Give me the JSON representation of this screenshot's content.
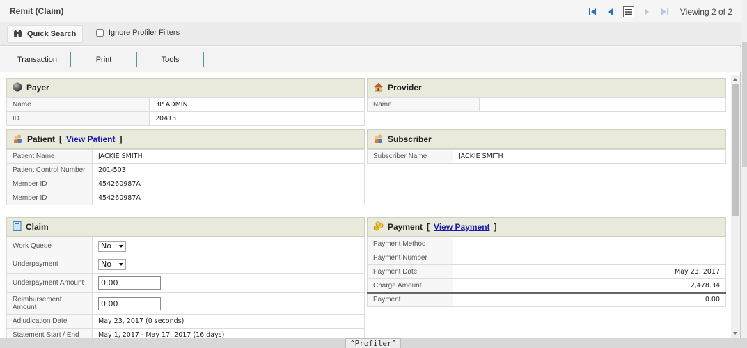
{
  "window": {
    "title": "Remit (Claim)",
    "viewing": "Viewing 2 of 2"
  },
  "toolbar": {
    "quick_search": "Quick Search",
    "ignore_filters": "Ignore Profiler Filters"
  },
  "tabs": [
    "Transaction",
    "Print",
    "Tools"
  ],
  "payer": {
    "title": "Payer",
    "rows": [
      {
        "label": "Name",
        "value": "3P ADMIN"
      },
      {
        "label": "ID",
        "value": "20413"
      }
    ]
  },
  "provider": {
    "title": "Provider",
    "rows": [
      {
        "label": "Name",
        "value": ""
      }
    ]
  },
  "patient": {
    "title": "Patient",
    "bracket_open": "[",
    "link": "View Patient",
    "bracket_close": "]",
    "rows": [
      {
        "label": "Patient Name",
        "value": "JACKIE SMITH"
      },
      {
        "label": "Patient Control Number",
        "value": "201-503"
      },
      {
        "label": "Member ID",
        "value": "454260987A"
      },
      {
        "label": "Member ID",
        "value": "454260987A"
      }
    ]
  },
  "subscriber": {
    "title": "Subscriber",
    "rows": [
      {
        "label": "Subscriber Name",
        "value": "JACKIE SMITH"
      }
    ]
  },
  "claim": {
    "title": "Claim",
    "work_queue_label": "Work Queue",
    "work_queue_value": "No",
    "underpayment_label": "Underpayment",
    "underpayment_value": "No",
    "underpayment_amount_label": "Underpayment Amount",
    "underpayment_amount_value": "0.00",
    "reimbursement_amount_label": "Reimbursement Amount",
    "reimbursement_amount_value": "0.00",
    "adjudication_label": "Adjudication Date",
    "adjudication_value": "May 23, 2017 (0 seconds)",
    "statement_label": "Statement Start / End",
    "statement_value": "May 1, 2017 - May 17, 2017 (16 days)"
  },
  "payment": {
    "title": "Payment",
    "bracket_open": "[",
    "link": "View Payment",
    "bracket_close": "]",
    "rows": [
      {
        "label": "Payment Method",
        "value": ""
      },
      {
        "label": "Payment Number",
        "value": ""
      },
      {
        "label": "Payment Date",
        "value": "May 23, 2017"
      },
      {
        "label": "Charge Amount",
        "value": "2,478.34"
      },
      {
        "label": "Payment",
        "value": "0.00"
      }
    ]
  },
  "profiler": {
    "label": "^Profiler^"
  },
  "colors": {
    "panel_header": "#e9e9dc",
    "tab_divider": "#4a9aa0",
    "link": "#1a1ab0"
  }
}
